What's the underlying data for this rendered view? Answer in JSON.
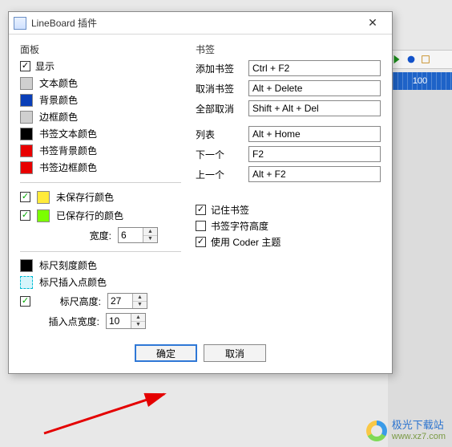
{
  "dialog": {
    "title": "LineBoard 插件",
    "close_glyph": "✕"
  },
  "panel": {
    "title": "面板",
    "show": {
      "label": "显示",
      "checked": true
    },
    "colors": {
      "text": {
        "label": "文本颜色",
        "swatch": "#cfcfcf"
      },
      "bg": {
        "label": "背景颜色",
        "swatch": "#0a3fb8"
      },
      "border": {
        "label": "边框颜色",
        "swatch": "#cfcfcf"
      },
      "bm_text": {
        "label": "书签文本颜色",
        "swatch": "#000000"
      },
      "bm_bg": {
        "label": "书签背景颜色",
        "swatch": "#e80000"
      },
      "bm_border": {
        "label": "书签边框颜色",
        "swatch": "#e80000"
      }
    },
    "unsaved": {
      "label": "未保存行颜色",
      "checked": true,
      "swatch": "#ffeb3b"
    },
    "saved": {
      "label": "已保存行的颜色",
      "checked": true,
      "swatch": "#7bff00"
    },
    "width": {
      "label": "宽度:",
      "value": "6"
    },
    "ruler_scale": {
      "label": "标尺刻度颜色",
      "swatch": "#000000"
    },
    "ruler_insert": {
      "label": "标尺插入点颜色",
      "swatch_style": "dashed"
    },
    "ruler_enable": {
      "checked": true
    },
    "ruler_height": {
      "label": "标尺高度:",
      "value": "27"
    },
    "insert_width": {
      "label": "插入点宽度:",
      "value": "10"
    }
  },
  "bookmark": {
    "title": "书签",
    "add": {
      "label": "添加书签",
      "value": "Ctrl + F2"
    },
    "remove": {
      "label": "取消书签",
      "value": "Alt + Delete"
    },
    "remove_all": {
      "label": "全部取消",
      "value": "Shift + Alt + Del"
    },
    "list": {
      "label": "列表",
      "value": "Alt + Home"
    },
    "next": {
      "label": "下一个",
      "value": "F2"
    },
    "prev": {
      "label": "上一个",
      "value": "Alt + F2"
    },
    "remember": {
      "label": "记住书签",
      "checked": true
    },
    "char_h": {
      "label": "书签字符高度",
      "checked": false
    },
    "coder": {
      "label": "使用 Coder 主题",
      "checked": true
    }
  },
  "buttons": {
    "ok": "确定",
    "cancel": "取消"
  },
  "bg": {
    "ruler_mark": "100"
  },
  "watermark": {
    "line1": "极光下载站",
    "line2": "www.xz7.com"
  }
}
